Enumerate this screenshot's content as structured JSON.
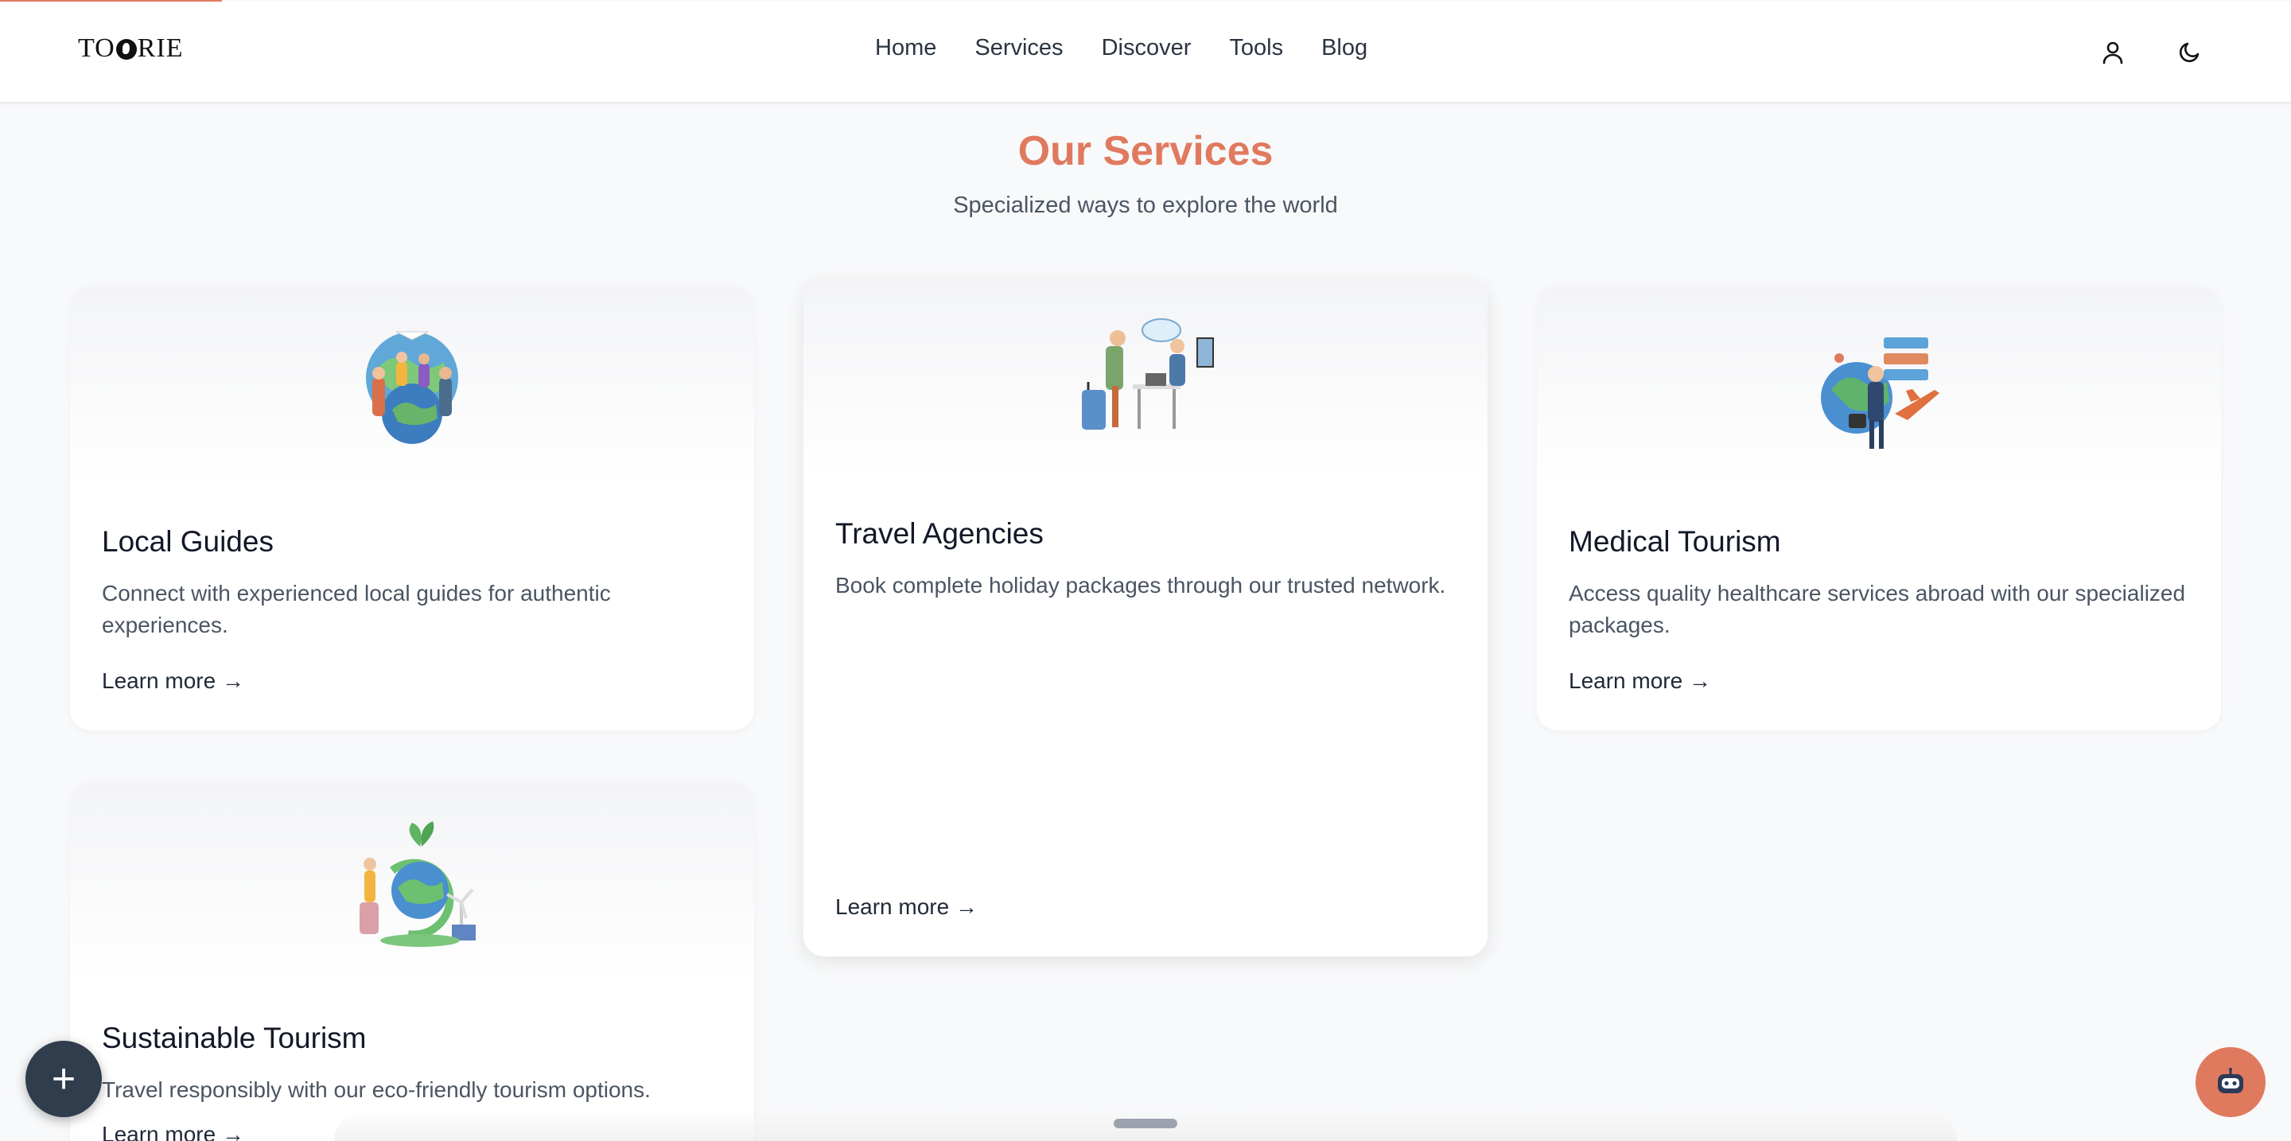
{
  "progress": {
    "fraction": 0.097
  },
  "header": {
    "logo_text": "TOORIE",
    "nav": [
      "Home",
      "Services",
      "Discover",
      "Tools",
      "Blog"
    ],
    "account_icon": "user-icon",
    "theme_icon": "moon-icon"
  },
  "section": {
    "title": "Our Services",
    "subtitle": "Specialized ways to explore the world"
  },
  "cards": [
    {
      "title": "Local Guides",
      "description": "Connect with experienced local guides for authentic experiences.",
      "link": "Learn more →",
      "illustration": "globe-travelers-illustration"
    },
    {
      "title": "Travel Agencies",
      "description": "Book complete holiday packages through our trusted network.",
      "link": "Learn more →",
      "illustration": "travel-agent-desk-illustration"
    },
    {
      "title": "Medical Tourism",
      "description": "Access quality healthcare services abroad with our specialized packages.",
      "link": "Learn more →",
      "illustration": "businessman-globe-plane-illustration"
    },
    {
      "title": "Sustainable Tourism",
      "description": "Travel responsibly with our eco-friendly tourism options.",
      "link": "Learn more →",
      "illustration": "eco-globe-illustration"
    }
  ],
  "fab": {
    "label": "+"
  },
  "colors": {
    "accent": "#e07a5f",
    "fab": "#2f3d4c"
  }
}
